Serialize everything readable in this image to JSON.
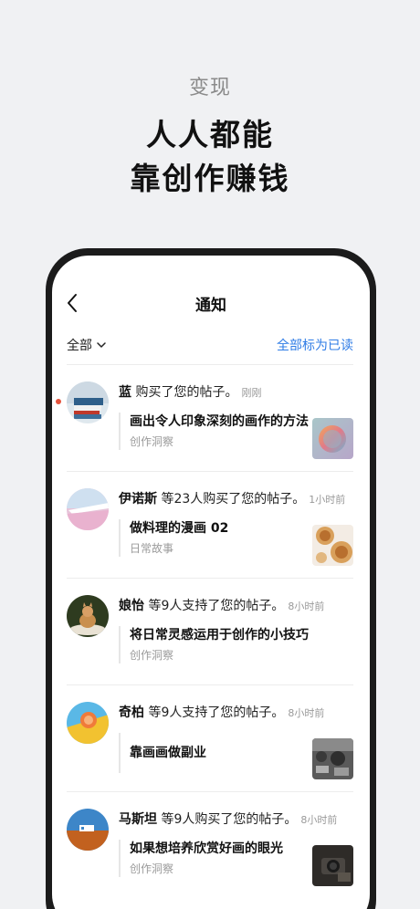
{
  "promo": {
    "subtitle": "变现",
    "title_line1": "人人都能",
    "title_line2": "靠创作赚钱"
  },
  "nav": {
    "title": "通知",
    "back_icon": "chevron-left-icon"
  },
  "filter": {
    "selected": "全部",
    "mark_all_read": "全部标为已读"
  },
  "notifications": [
    {
      "user": "蓝",
      "action": " 购买了您的帖子。",
      "time": "刚刚",
      "unread": true,
      "post_title": "画出令人印象深刻的画作的方法",
      "category": "创作洞察"
    },
    {
      "user": "伊诺斯",
      "action": " 等23人购买了您的帖子。",
      "time": "1小时前",
      "unread": false,
      "post_title": "做料理的漫画 02",
      "category": "日常故事"
    },
    {
      "user": "娘怡",
      "action": " 等9人支持了您的帖子。",
      "time": "8小时前",
      "unread": false,
      "post_title": "将日常灵感运用于创作的小技巧",
      "category": "创作洞察"
    },
    {
      "user": "奇柏",
      "action": " 等9人支持了您的帖子。",
      "time": "8小时前",
      "unread": false,
      "post_title": "靠画画做副业",
      "category": ""
    },
    {
      "user": "马斯坦",
      "action": " 等9人购买了您的帖子。",
      "time": "8小时前",
      "unread": false,
      "post_title": "如果想培养欣赏好画的眼光",
      "category": "创作洞察"
    }
  ],
  "colors": {
    "accent": "#2f7ce6",
    "unread_dot": "#e5533c",
    "background": "#f0f1f3"
  }
}
